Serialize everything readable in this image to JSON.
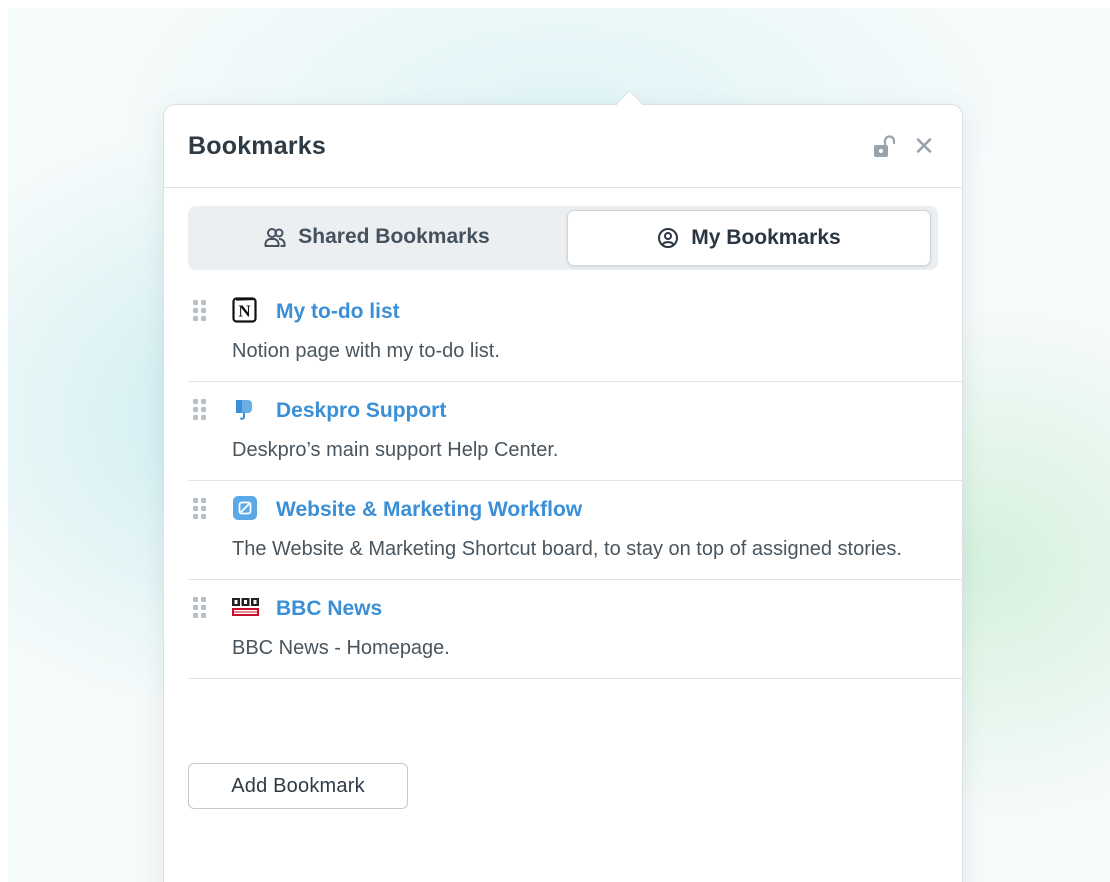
{
  "panel": {
    "title": "Bookmarks",
    "lock_icon": "unlock-icon",
    "close_icon": "close-icon",
    "close_glyph": "✕"
  },
  "tabs": [
    {
      "label": "Shared Bookmarks",
      "icon": "users-icon",
      "active": false
    },
    {
      "label": "My Bookmarks",
      "icon": "user-circle-icon",
      "active": true
    }
  ],
  "bookmarks": [
    {
      "title": "My to-do list",
      "description": "Notion page with my to-do list.",
      "icon": "notion-icon"
    },
    {
      "title": "Deskpro Support",
      "description": "Deskpro’s main support Help Center.",
      "icon": "deskpro-icon"
    },
    {
      "title": "Website & Marketing Workflow",
      "description": "The Website & Marketing Shortcut board, to stay on top of assigned stories.",
      "icon": "shortcut-icon"
    },
    {
      "title": "BBC News",
      "description": "BBC News - Homepage.",
      "icon": "bbc-news-icon"
    }
  ],
  "footer": {
    "add_label": "Add Bookmark"
  },
  "colors": {
    "link": "#3a8fd6",
    "title": "#2e3a44",
    "text": "#4a555e",
    "border": "#e1e4e8",
    "bbc_red": "#c8102e",
    "shortcut_blue": "#5aa9e6",
    "deskpro_blue": "#3a8fd6"
  }
}
